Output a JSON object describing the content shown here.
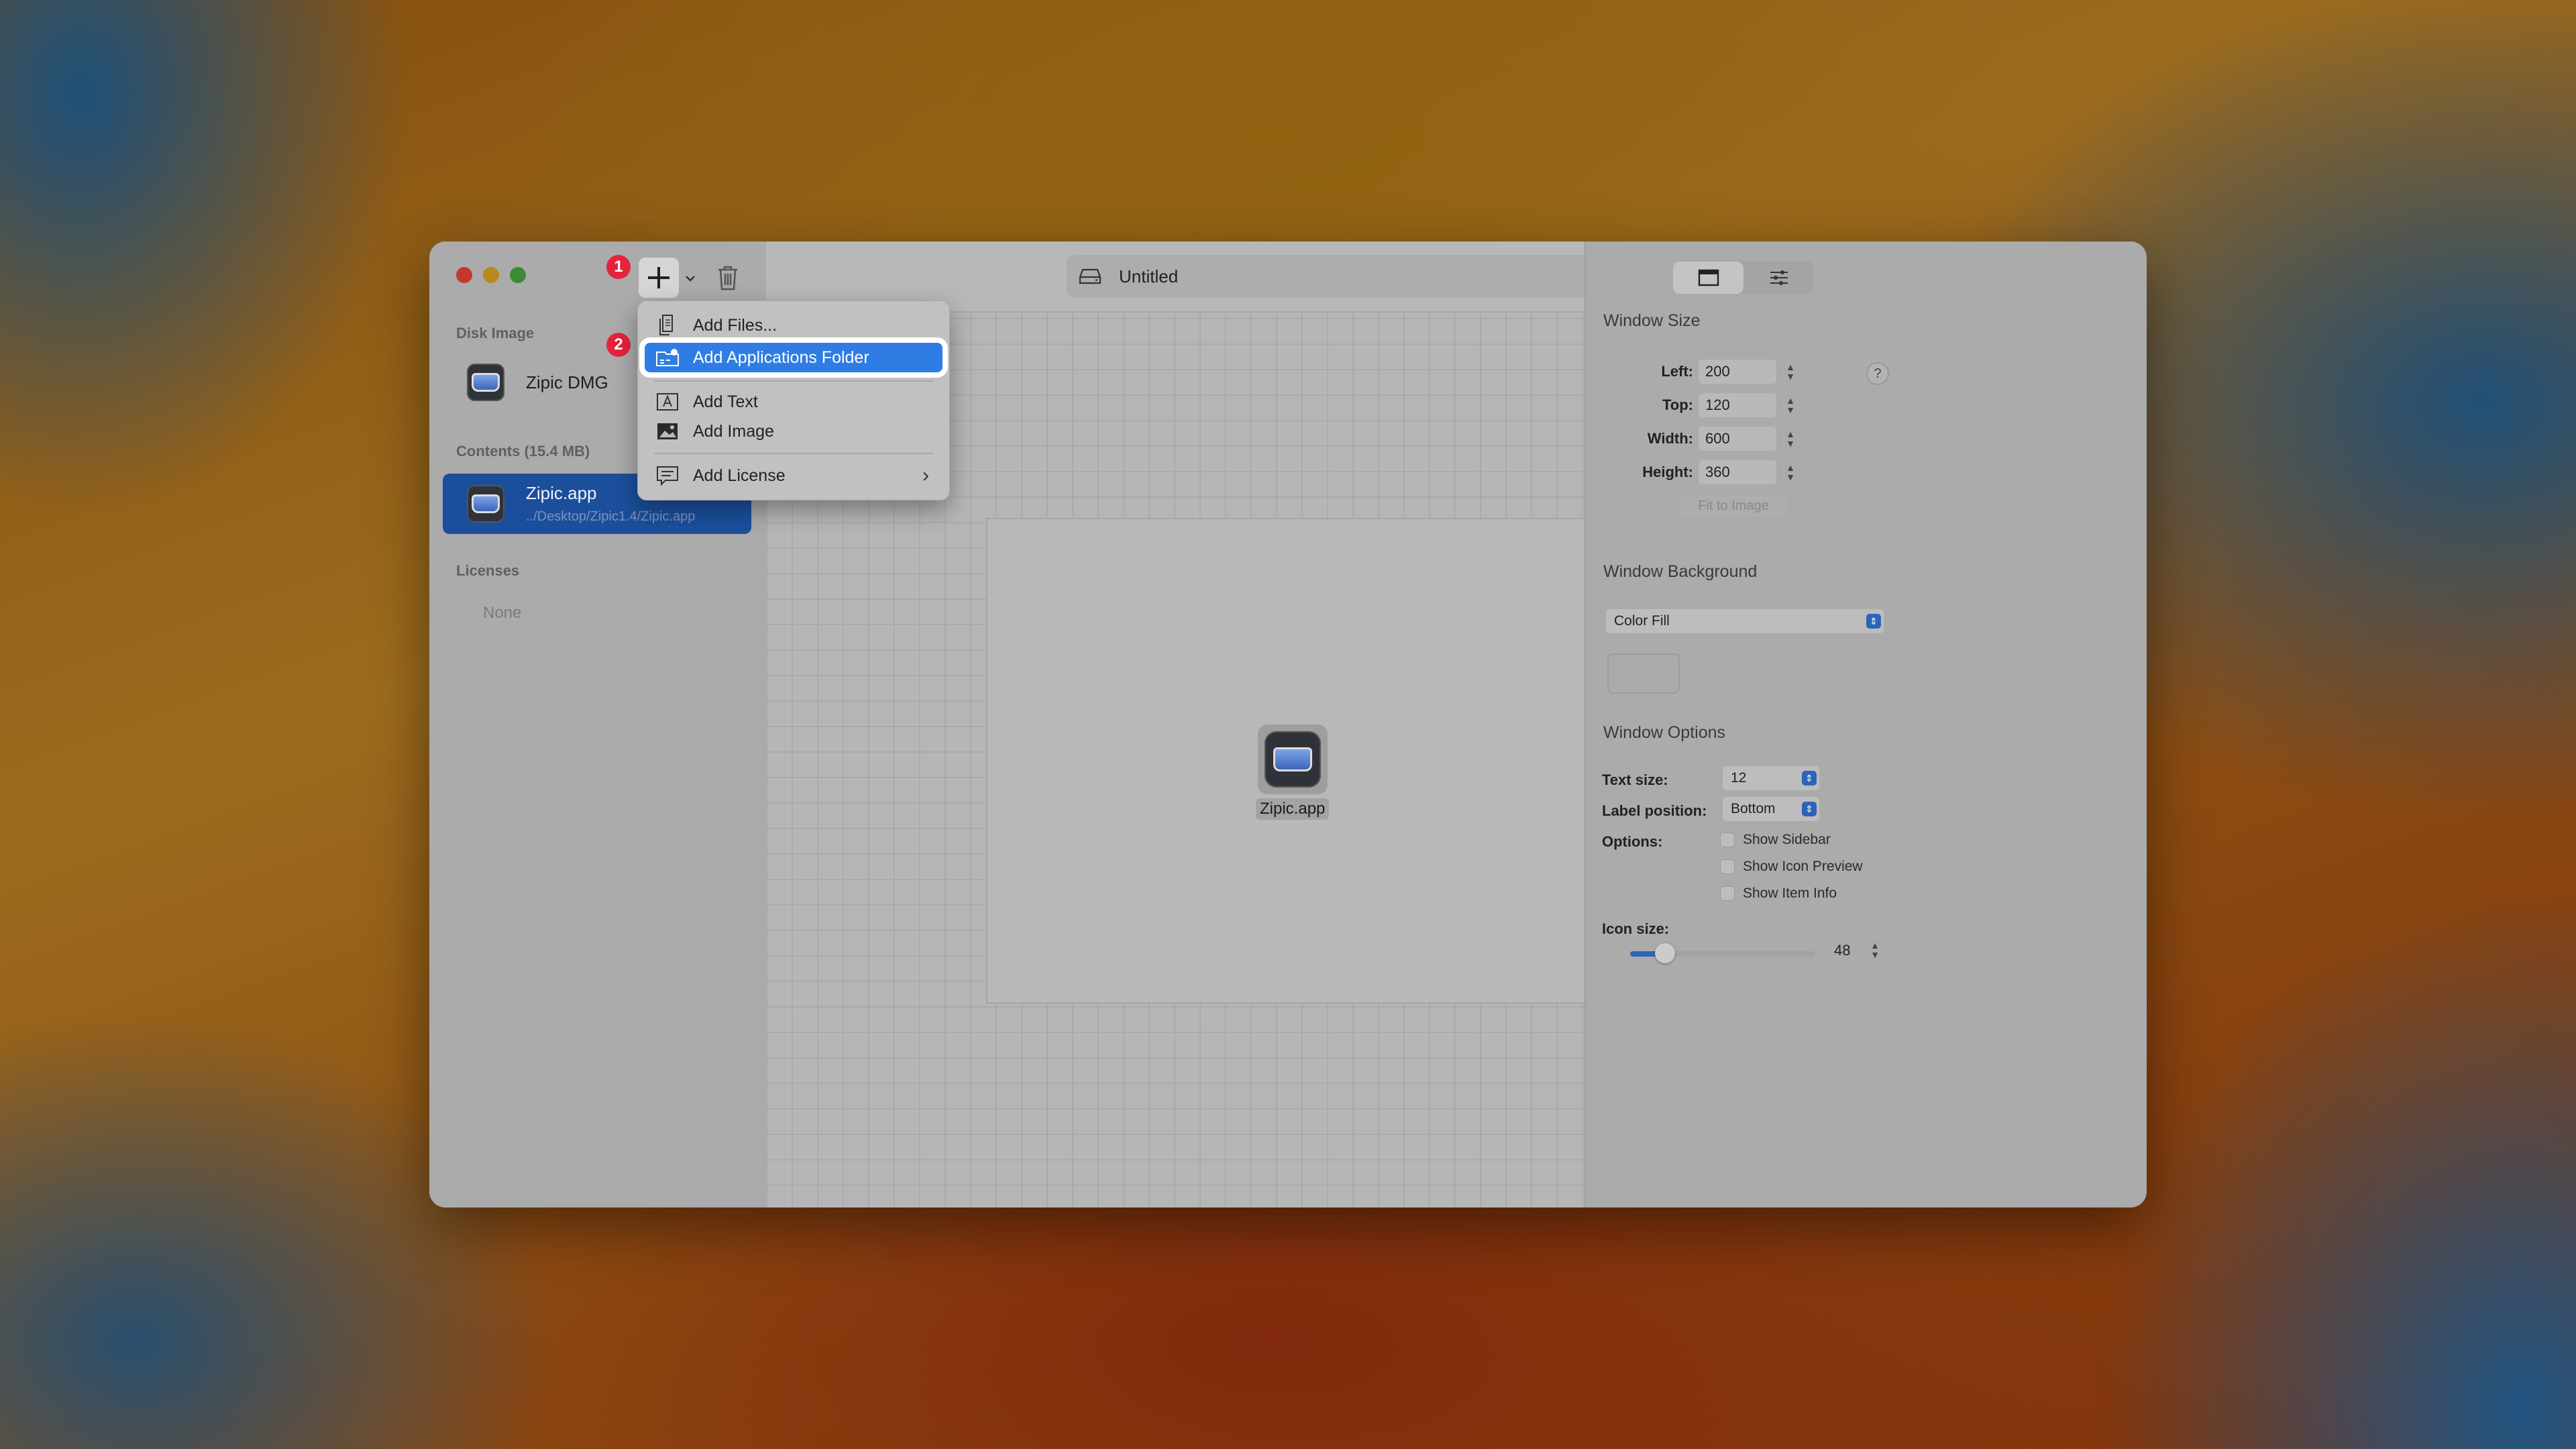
{
  "window_title": "Untitled",
  "badges": {
    "step1": "1",
    "step2": "2"
  },
  "sidebar": {
    "disk_image_heading": "Disk Image",
    "disk_name": "Zipic DMG",
    "contents_heading": "Contents (15.4 MB)",
    "content_item": {
      "name": "Zipic.app",
      "path": "../Desktop/Zipic1.4/Zipic.app"
    },
    "licenses_heading": "Licenses",
    "licenses_none": "None"
  },
  "menu": {
    "items": [
      {
        "label": "Add Files...",
        "icon": "doc-icon"
      },
      {
        "label": "Add Applications Folder",
        "icon": "applications-folder-icon",
        "highlighted": true
      },
      {
        "label": "Add Text",
        "icon": "text-icon"
      },
      {
        "label": "Add Image",
        "icon": "image-icon"
      },
      {
        "label": "Add License",
        "icon": "license-icon",
        "submenu": true
      }
    ]
  },
  "canvas": {
    "item_label": "Zipic.app"
  },
  "inspector": {
    "window_size_heading": "Window Size",
    "left_label": "Left:",
    "left_value": "200",
    "top_label": "Top:",
    "top_value": "120",
    "width_label": "Width:",
    "width_value": "600",
    "height_label": "Height:",
    "height_value": "360",
    "help": "?",
    "fit_to_image": "Fit to Image",
    "window_background_heading": "Window Background",
    "background_select": "Color Fill",
    "window_options_heading": "Window Options",
    "text_size_label": "Text size:",
    "text_size_value": "12",
    "label_position_label": "Label position:",
    "label_position_value": "Bottom",
    "options_label": "Options:",
    "options": [
      "Show Sidebar",
      "Show Icon Preview",
      "Show Item Info"
    ],
    "icon_size_label": "Icon size:",
    "icon_size_value": "48",
    "icon_size_fraction": 0.15
  },
  "colors": {
    "accent": "#2f7de4",
    "badge": "#e5233a",
    "selection": "#1b4f9c"
  }
}
